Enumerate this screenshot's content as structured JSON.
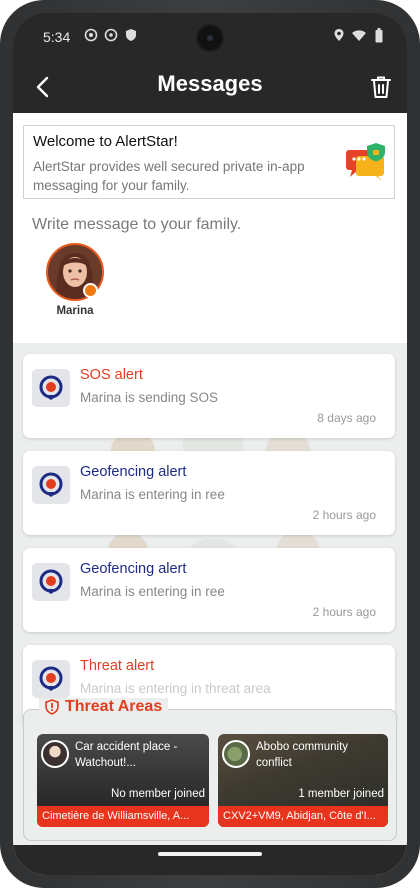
{
  "status_bar": {
    "time": "5:34"
  },
  "header": {
    "title": "Messages"
  },
  "welcome": {
    "title": "Welcome to AlertStar!",
    "body": "AlertStar provides well secured private in-app messaging for your family."
  },
  "compose": {
    "prompt": "Write message to your family."
  },
  "members": [
    {
      "name": "Marina"
    }
  ],
  "alerts": [
    {
      "title": "SOS alert",
      "message": "Marina is sending SOS",
      "time": "8 days ago",
      "color": "#e23d1f"
    },
    {
      "title": "Geofencing alert",
      "message": "Marina is entering in ree",
      "time": "2 hours ago",
      "color": "#1d2b85"
    },
    {
      "title": "Geofencing alert",
      "message": "Marina is entering in ree",
      "time": "2 hours ago",
      "color": "#1d2b85"
    },
    {
      "title": "Threat alert",
      "message": "Marina is entering in threat area",
      "time": "",
      "color": "#e23d1f"
    }
  ],
  "threat_areas": {
    "label": "Threat Areas",
    "items": [
      {
        "title": "Car accident place - Watchout!...",
        "joined": "No member joined",
        "location": "Cimetière de Williamsville, A..."
      },
      {
        "title": "Abobo community conflict",
        "joined": "1 member joined",
        "location": "CXV2+VM9, Abidjan, Côte d'I..."
      }
    ]
  },
  "colors": {
    "accent_red": "#e23d1f",
    "accent_blue": "#1d2b85",
    "status_orange": "#f07a12"
  }
}
